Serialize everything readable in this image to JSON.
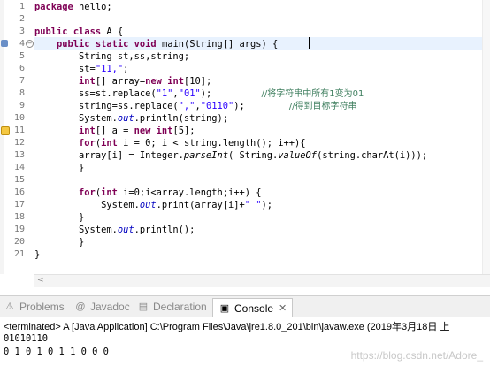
{
  "editor": {
    "line_numbers": [
      "1",
      "2",
      "3",
      "4",
      "5",
      "6",
      "7",
      "8",
      "9",
      "10",
      "11",
      "12",
      "13",
      "14",
      "15",
      "16",
      "17",
      "18",
      "19",
      "20",
      "21"
    ],
    "lines": [
      [
        {
          "t": "package",
          "c": "kw"
        },
        {
          "t": " hello;",
          "c": ""
        }
      ],
      [],
      [
        {
          "t": "public",
          "c": "kw"
        },
        {
          "t": " ",
          "c": ""
        },
        {
          "t": "class",
          "c": "kw"
        },
        {
          "t": " A {",
          "c": ""
        }
      ],
      [
        {
          "t": "    ",
          "c": ""
        },
        {
          "t": "public",
          "c": "kw"
        },
        {
          "t": " ",
          "c": ""
        },
        {
          "t": "static",
          "c": "kw"
        },
        {
          "t": " ",
          "c": ""
        },
        {
          "t": "void",
          "c": "kw"
        },
        {
          "t": " main(String[] args) {",
          "c": ""
        }
      ],
      [
        {
          "t": "        String st,ss,string;",
          "c": ""
        }
      ],
      [
        {
          "t": "        st=",
          "c": ""
        },
        {
          "t": "\"11,\"",
          "c": "str"
        },
        {
          "t": ";",
          "c": ""
        }
      ],
      [
        {
          "t": "        ",
          "c": ""
        },
        {
          "t": "int",
          "c": "kw"
        },
        {
          "t": "[] array=",
          "c": ""
        },
        {
          "t": "new",
          "c": "kw"
        },
        {
          "t": " ",
          "c": ""
        },
        {
          "t": "int",
          "c": "kw"
        },
        {
          "t": "[10];",
          "c": ""
        }
      ],
      [
        {
          "t": "        ss=st.replace(",
          "c": ""
        },
        {
          "t": "\"1\"",
          "c": "str"
        },
        {
          "t": ",",
          "c": ""
        },
        {
          "t": "\"01\"",
          "c": "str"
        },
        {
          "t": ");         ",
          "c": ""
        },
        {
          "t": "//将字符串中所有1变为01",
          "c": "cmt"
        }
      ],
      [
        {
          "t": "        string=ss.replace(",
          "c": ""
        },
        {
          "t": "\",\"",
          "c": "str"
        },
        {
          "t": ",",
          "c": ""
        },
        {
          "t": "\"0110\"",
          "c": "str"
        },
        {
          "t": ");        ",
          "c": ""
        },
        {
          "t": "//得到目标字符串",
          "c": "cmt"
        }
      ],
      [
        {
          "t": "        System.",
          "c": ""
        },
        {
          "t": "out",
          "c": "fld"
        },
        {
          "t": ".println(string);",
          "c": ""
        }
      ],
      [
        {
          "t": "        ",
          "c": ""
        },
        {
          "t": "int",
          "c": "kw"
        },
        {
          "t": "[] a = ",
          "c": ""
        },
        {
          "t": "new",
          "c": "kw"
        },
        {
          "t": " ",
          "c": ""
        },
        {
          "t": "int",
          "c": "kw"
        },
        {
          "t": "[5];",
          "c": ""
        }
      ],
      [
        {
          "t": "        ",
          "c": ""
        },
        {
          "t": "for",
          "c": "kw"
        },
        {
          "t": "(",
          "c": ""
        },
        {
          "t": "int",
          "c": "kw"
        },
        {
          "t": " i = 0; i < string.length(); i++){",
          "c": ""
        }
      ],
      [
        {
          "t": "        array[i] = Integer.",
          "c": ""
        },
        {
          "t": "parseInt",
          "c": "ital"
        },
        {
          "t": "( String.",
          "c": ""
        },
        {
          "t": "valueOf",
          "c": "ital"
        },
        {
          "t": "(string.charAt(i)));",
          "c": ""
        }
      ],
      [
        {
          "t": "        }",
          "c": ""
        }
      ],
      [],
      [
        {
          "t": "        ",
          "c": ""
        },
        {
          "t": "for",
          "c": "kw"
        },
        {
          "t": "(",
          "c": ""
        },
        {
          "t": "int",
          "c": "kw"
        },
        {
          "t": " i=0;i<array.length;i++) {",
          "c": ""
        }
      ],
      [
        {
          "t": "            System.",
          "c": ""
        },
        {
          "t": "out",
          "c": "fld"
        },
        {
          "t": ".print(array[i]+",
          "c": ""
        },
        {
          "t": "\" \"",
          "c": "str"
        },
        {
          "t": ");",
          "c": ""
        }
      ],
      [
        {
          "t": "        }",
          "c": ""
        }
      ],
      [
        {
          "t": "        System.",
          "c": ""
        },
        {
          "t": "out",
          "c": "fld"
        },
        {
          "t": ".println();",
          "c": ""
        }
      ],
      [
        {
          "t": "        }",
          "c": ""
        }
      ],
      [
        {
          "t": "}",
          "c": ""
        }
      ]
    ]
  },
  "bottom_tabs": [
    {
      "label": "Problems",
      "icon": "problems-icon",
      "glyph": "⚠"
    },
    {
      "label": "Javadoc",
      "icon": "javadoc-icon",
      "glyph": "@"
    },
    {
      "label": "Declaration",
      "icon": "declaration-icon",
      "glyph": "▤"
    },
    {
      "label": "Console",
      "icon": "console-icon",
      "glyph": "▣",
      "close": "✕"
    }
  ],
  "console": {
    "header": "<terminated> A [Java Application] C:\\Program Files\\Java\\jre1.8.0_201\\bin\\javaw.exe (2019年3月18日 上",
    "output": [
      "01010110",
      "0 1 0 1 0 1 1 0 0 0"
    ]
  },
  "watermark": "https://blog.csdn.net/Adore_",
  "colors": {
    "keyword": "#7f0055",
    "string": "#2a00ff",
    "comment": "#3f7f5f",
    "field": "#0000c0"
  }
}
